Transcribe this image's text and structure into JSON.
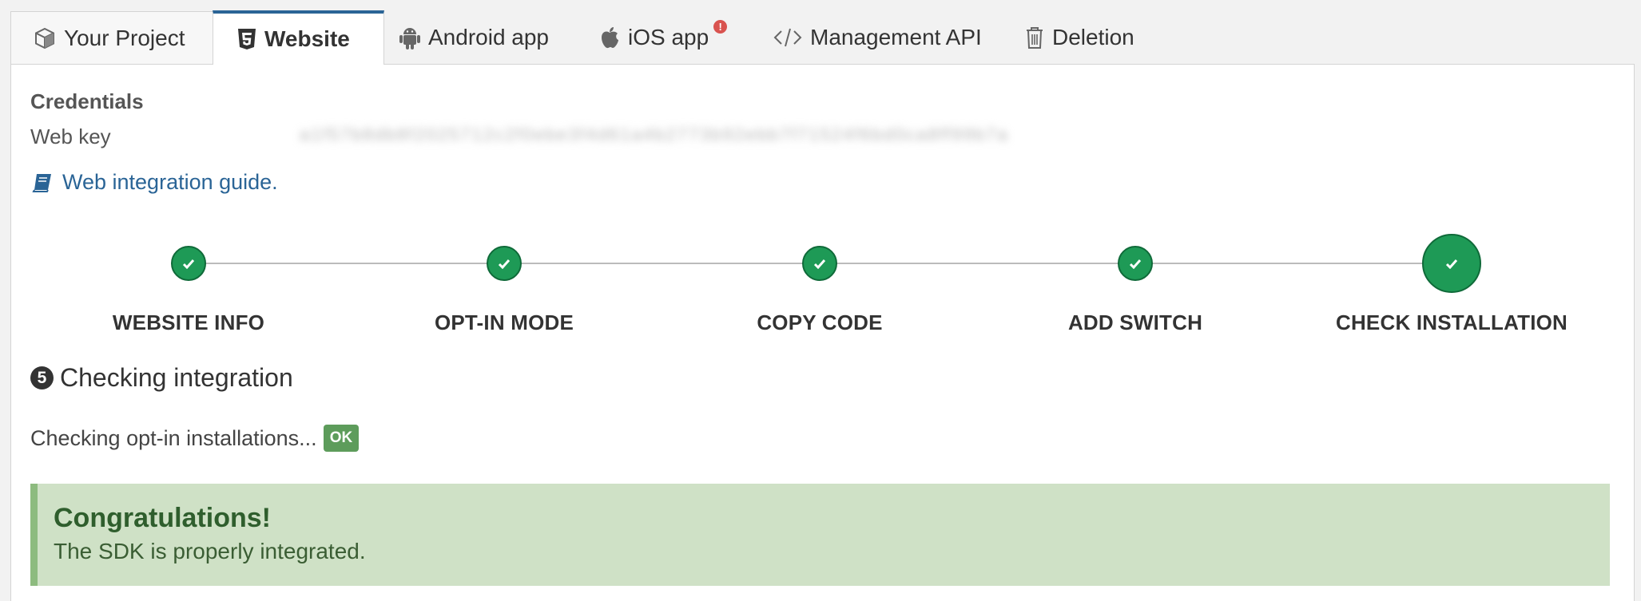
{
  "tabs": [
    {
      "label": "Your Project",
      "icon": "cube-icon"
    },
    {
      "label": "Website",
      "icon": "html5-icon",
      "active": true
    },
    {
      "label": "Android app",
      "icon": "android-icon"
    },
    {
      "label": "iOS app",
      "icon": "apple-icon",
      "badge": "!"
    },
    {
      "label": "Management API",
      "icon": "code-icon"
    },
    {
      "label": "Deletion",
      "icon": "trash-icon"
    }
  ],
  "credentials": {
    "title": "Credentials",
    "web_key_label": "Web key",
    "web_key_value": "a1f57b8db8f2025712c2f0ebe3f4d61a4b2773b92ebb7f71524f6bd0ca8ff99b7a"
  },
  "guide": {
    "label": "Web integration guide."
  },
  "steps": [
    {
      "label": "WEBSITE INFO",
      "status": "done"
    },
    {
      "label": "OPT-IN MODE",
      "status": "done"
    },
    {
      "label": "COPY CODE",
      "status": "done"
    },
    {
      "label": "ADD SWITCH",
      "status": "done"
    },
    {
      "label": "CHECK INSTALLATION",
      "status": "current"
    }
  ],
  "section": {
    "number": "5",
    "title": "Checking integration"
  },
  "check": {
    "text": "Checking opt-in installations...",
    "badge": "OK"
  },
  "alert": {
    "title": "Congratulations!",
    "message": "The SDK is properly integrated."
  },
  "colors": {
    "accent": "#2a6496",
    "success": "#1e9a56",
    "alert_bg": "#cfe1c6",
    "alert_border": "#8dbb7f",
    "ok_badge": "#5d9c5b"
  }
}
